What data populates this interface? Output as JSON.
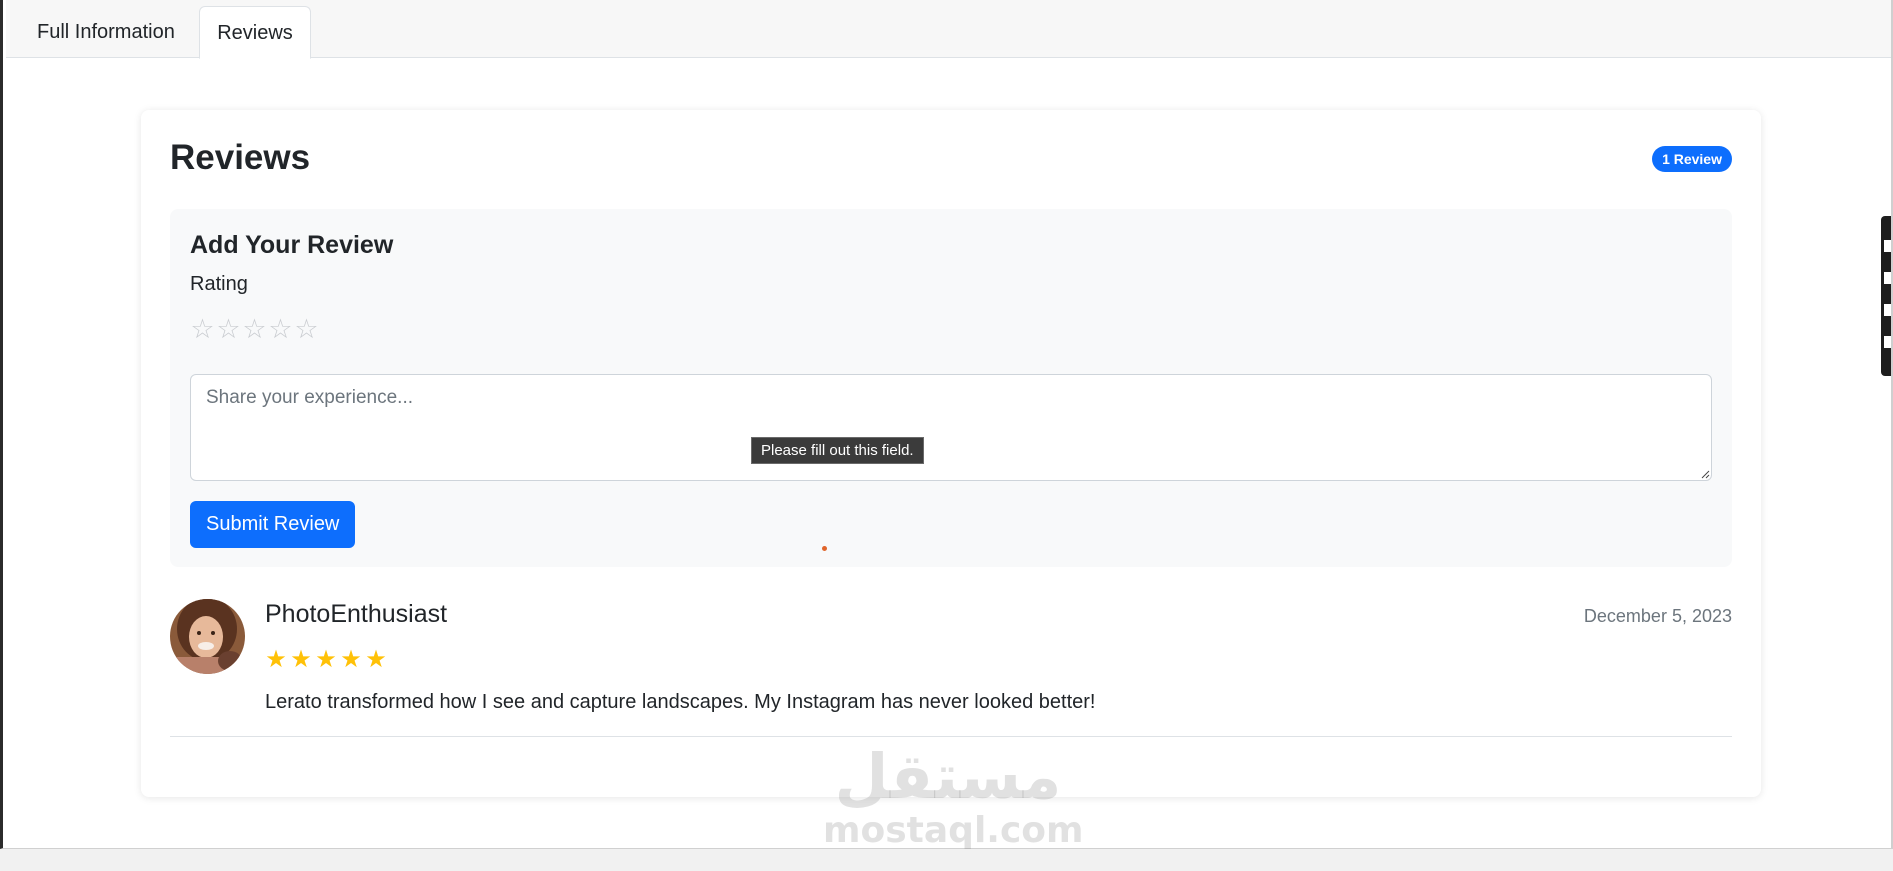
{
  "tabs": [
    {
      "label": "Full Information",
      "active": false
    },
    {
      "label": "Reviews",
      "active": true
    }
  ],
  "reviews_section": {
    "title": "Reviews",
    "count_badge": "1 Review",
    "badge_color": "#0d6efd"
  },
  "review_form": {
    "title": "Add Your Review",
    "rating_label": "Rating",
    "rating_value": 0,
    "rating_max": 5,
    "textarea_placeholder": "Share your experience...",
    "textarea_value": "",
    "validation_tooltip": "Please fill out this field.",
    "submit_label": "Submit Review"
  },
  "reviews": [
    {
      "author": "PhotoEnthusiast",
      "date": "December 5, 2023",
      "rating": 5,
      "text": "Lerato transformed how I see and capture landscapes. My Instagram has never looked better!"
    }
  ],
  "watermark": {
    "arabic": "مستقل",
    "latin": "mostaql.com"
  },
  "colors": {
    "primary": "#0d6efd",
    "star_filled": "#ffc107",
    "star_empty": "#c9ccd0"
  }
}
